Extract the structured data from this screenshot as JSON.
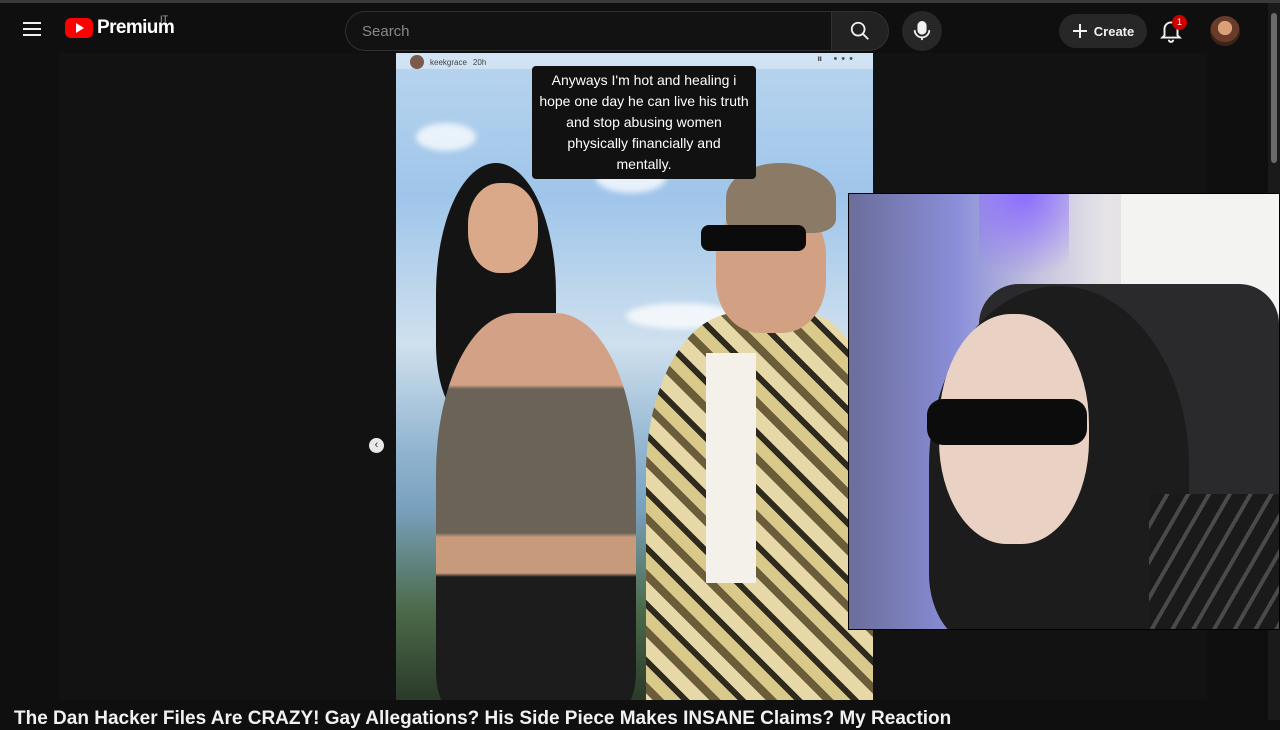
{
  "header": {
    "logo_text": "Premium",
    "country_code": "IT",
    "search": {
      "placeholder": "Search",
      "value": ""
    },
    "create_label": "Create",
    "notification_count": "1"
  },
  "video": {
    "story": {
      "username": "keekgrace",
      "age": "20h",
      "caption": "Anyways I'm hot and healing i hope one day he can live his truth and stop abusing women physically financially and mentally."
    },
    "title": "The Dan Hacker Files Are CRAZY! Gay Allegations? His Side Piece Makes INSANE Claims? My Reaction"
  },
  "colors": {
    "background": "#0f0f0f",
    "brand_red": "#ff0000",
    "badge_red": "#cc0000",
    "caption_bg": "#111111"
  },
  "icons": {
    "menu": "hamburger-icon",
    "logo": "youtube-logo-icon",
    "search": "search-icon",
    "mic": "microphone-icon",
    "create": "plus-icon",
    "bell": "bell-icon",
    "prev": "chevron-left-icon"
  }
}
